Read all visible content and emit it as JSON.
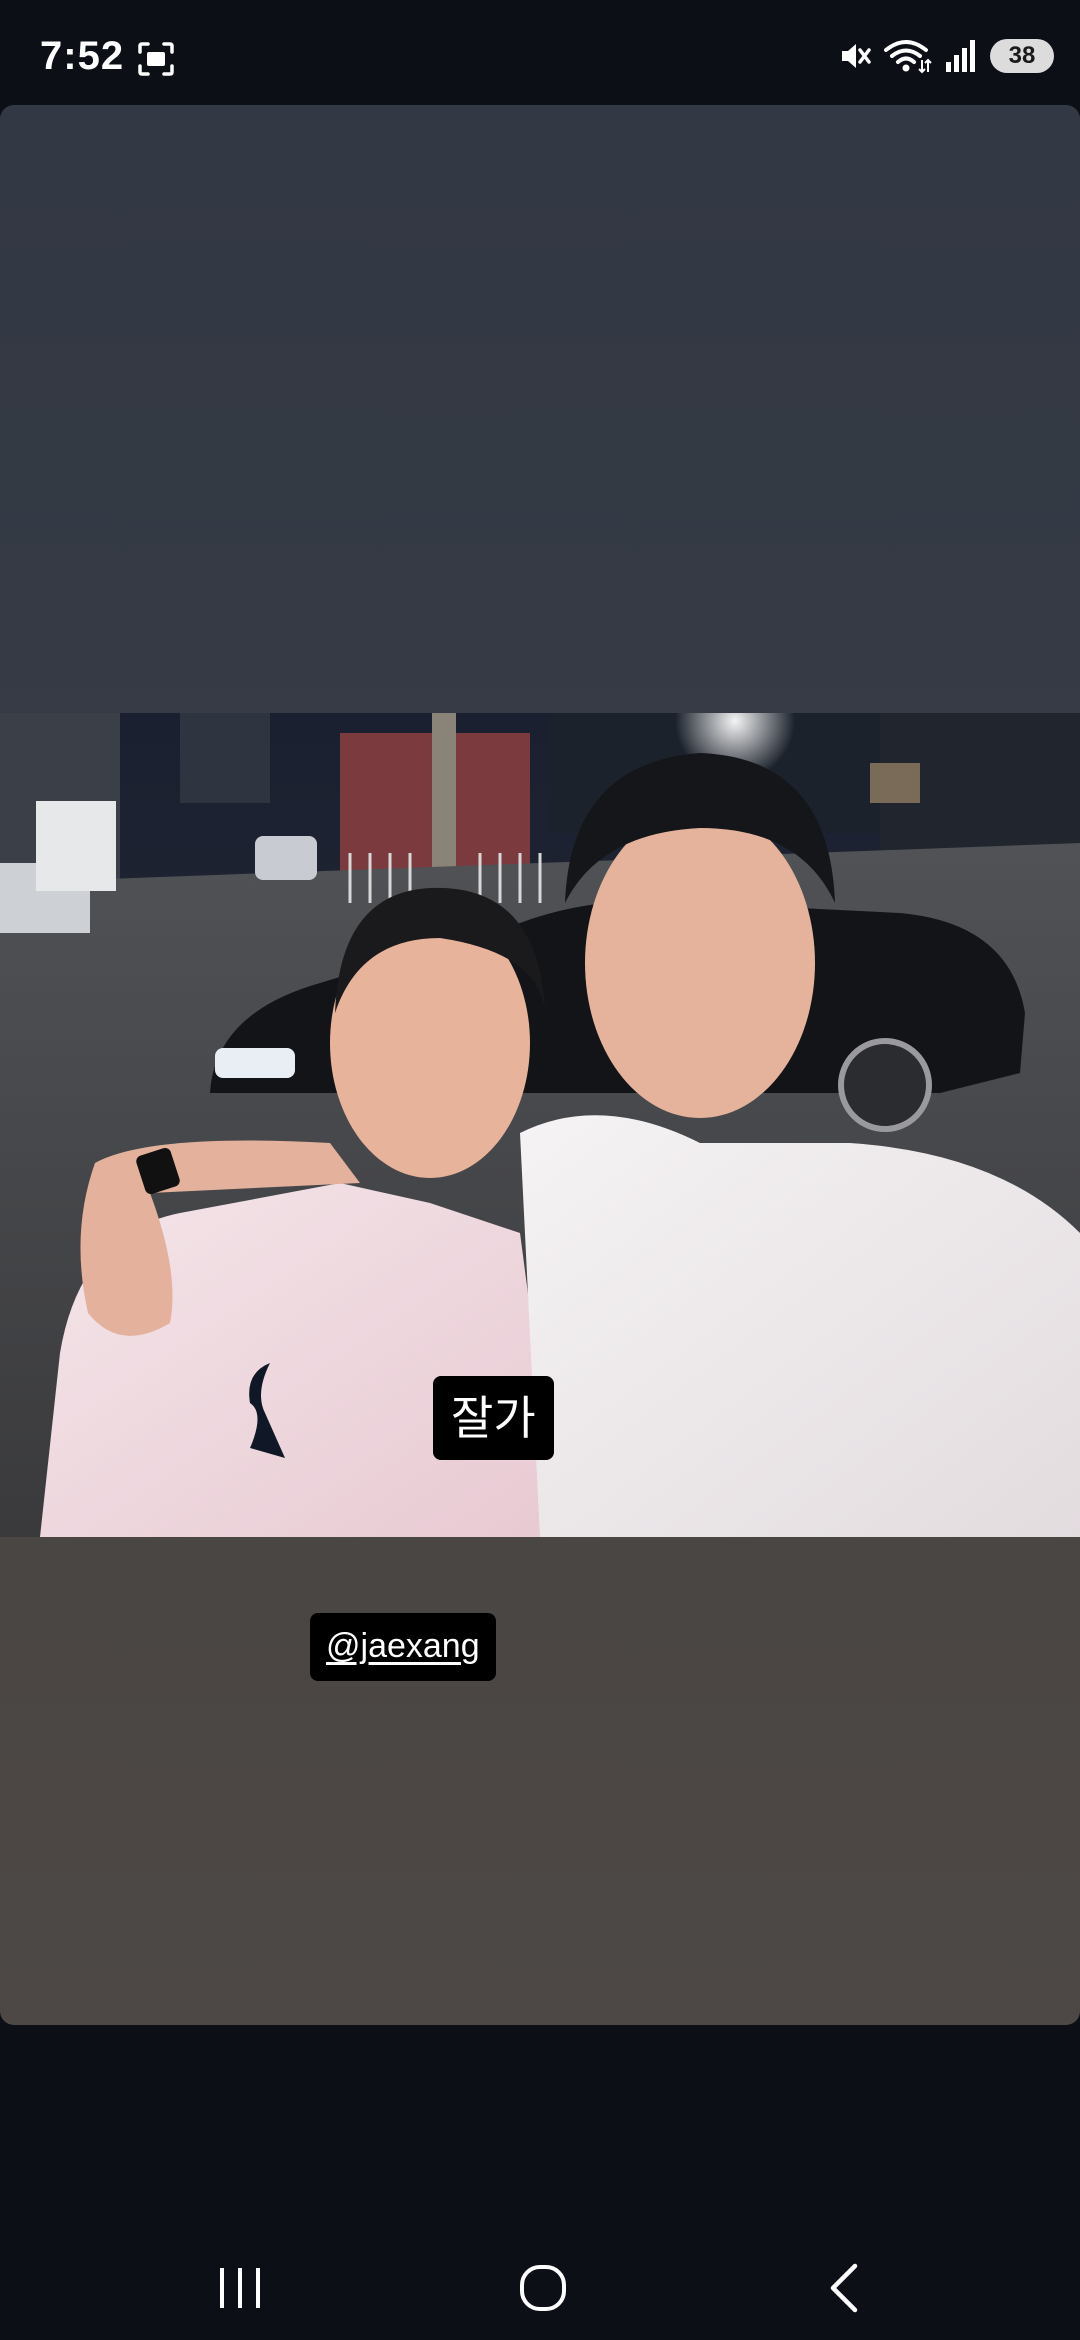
{
  "status_bar": {
    "time": "7:52",
    "battery": "38",
    "icons": [
      "screenshot-icon",
      "mute-icon",
      "wifi-icon",
      "signal-icon"
    ]
  },
  "story": {
    "photo_description_icon": "photo",
    "text_sticker": "잘가",
    "mention_sticker": "@jaexang"
  },
  "nav_bar": {
    "buttons": [
      "recents-icon",
      "home-icon",
      "back-icon"
    ]
  },
  "colors": {
    "background": "#0c0f16",
    "sticker_bg": "#000000",
    "sticker_text": "#ffffff"
  }
}
